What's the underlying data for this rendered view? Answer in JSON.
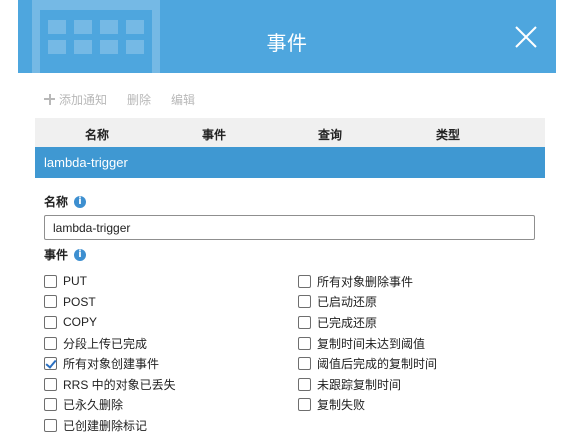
{
  "dialog": {
    "title": "事件",
    "close_icon": "close-icon"
  },
  "toolbar": {
    "add_label": "添加通知",
    "delete_label": "删除",
    "edit_label": "编辑"
  },
  "table": {
    "headers": [
      "名称",
      "事件",
      "查询",
      "类型"
    ],
    "rows": [
      {
        "name": "lambda-trigger"
      }
    ]
  },
  "form": {
    "name_label": "名称",
    "name_value": "lambda-trigger",
    "events_label": "事件",
    "events_left": [
      {
        "label": "PUT",
        "checked": false
      },
      {
        "label": "POST",
        "checked": false
      },
      {
        "label": "COPY",
        "checked": false
      },
      {
        "label": "分段上传已完成",
        "checked": false
      },
      {
        "label": "所有对象创建事件",
        "checked": true
      },
      {
        "label": "RRS 中的对象已丢失",
        "checked": false
      },
      {
        "label": "已永久删除",
        "checked": false
      },
      {
        "label": "已创建删除标记",
        "checked": false
      }
    ],
    "events_right": [
      {
        "label": "所有对象删除事件",
        "checked": false
      },
      {
        "label": "已启动还原",
        "checked": false
      },
      {
        "label": "已完成还原",
        "checked": false
      },
      {
        "label": "复制时间未达到阈值",
        "checked": false
      },
      {
        "label": "阈值后完成的复制时间",
        "checked": false
      },
      {
        "label": "未跟踪复制时间",
        "checked": false
      },
      {
        "label": "复制失败",
        "checked": false
      }
    ]
  },
  "colors": {
    "header_blue": "#4ea6de",
    "selected_row_blue": "#3f98d2"
  }
}
